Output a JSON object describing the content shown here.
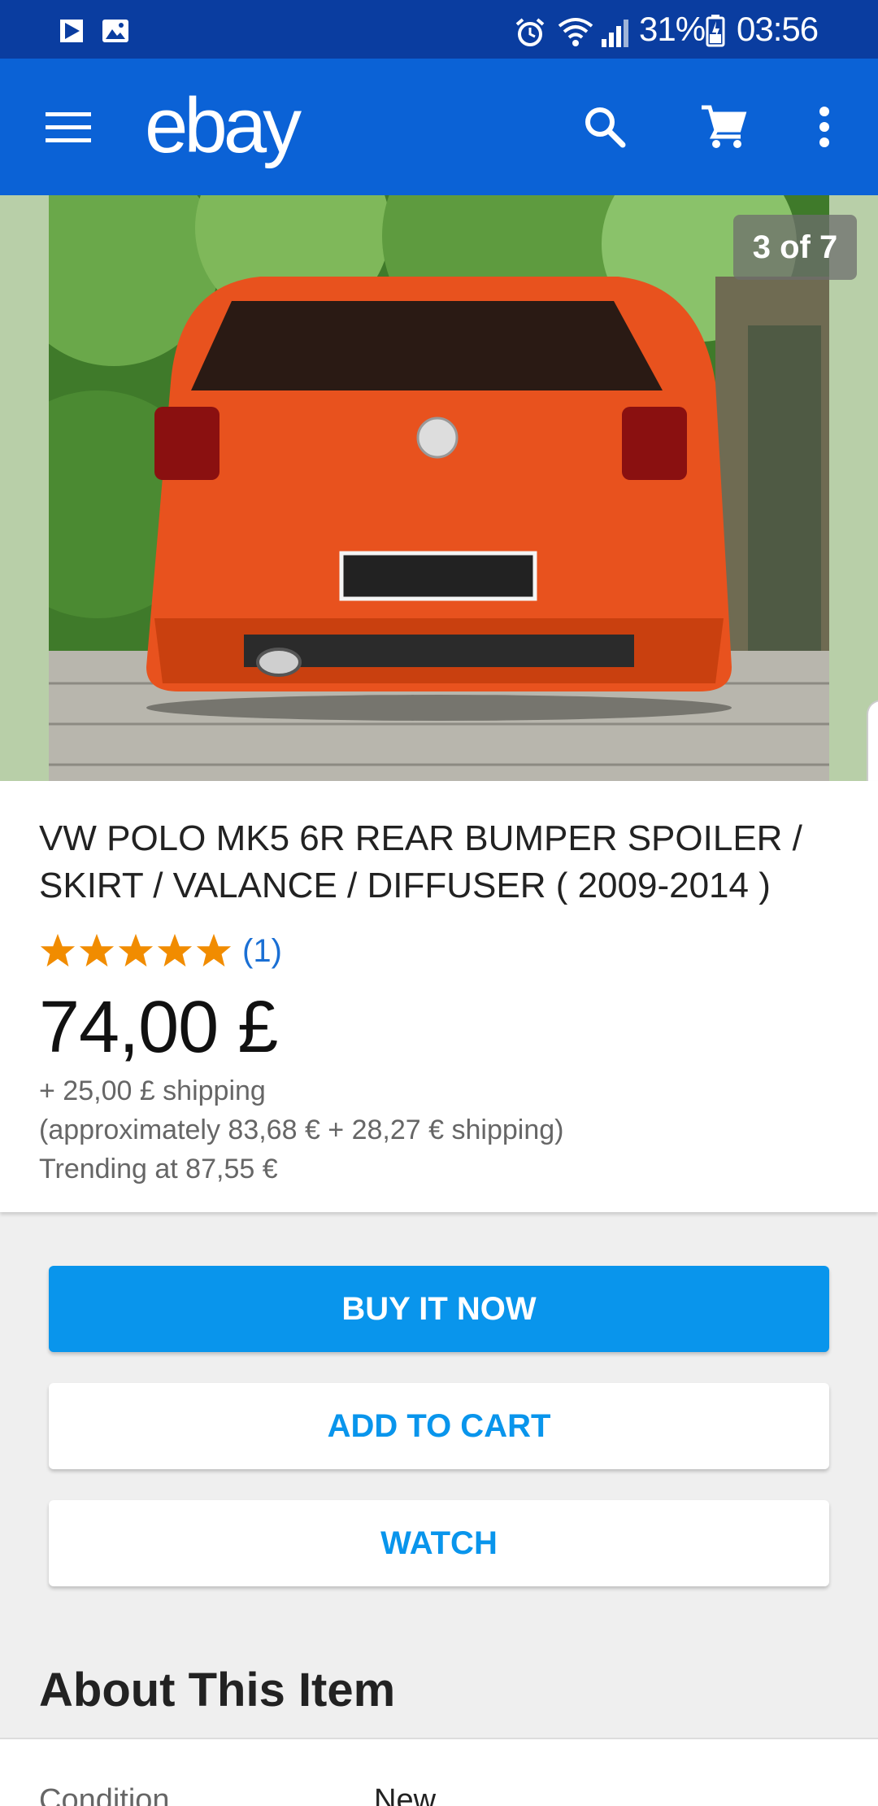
{
  "status_bar": {
    "battery": "31%",
    "time": "03:56"
  },
  "app_bar": {
    "logo": "ebay"
  },
  "gallery": {
    "counter": "3 of 7"
  },
  "item": {
    "title": "VW POLO MK5 6R REAR BUMPER SPOILER / SKIRT / VALANCE / DIFFUSER ( 2009-2014 )",
    "rating": 5,
    "rating_count": "(1)",
    "price": "74,00 £",
    "shipping": "+ 25,00 £ shipping",
    "approx": "(approximately 83,68 € + 28,27 € shipping)",
    "trending": "Trending at 87,55 €"
  },
  "actions": {
    "buy_now": "BUY IT NOW",
    "add_to_cart": "ADD TO CART",
    "watch": "WATCH"
  },
  "about": {
    "heading": "About This Item",
    "condition_label": "Condition",
    "condition_value": "New"
  },
  "colors": {
    "status_bar": "#0a3da0",
    "app_bar": "#0b62d6",
    "primary_button": "#0995ec",
    "star": "#f18c00",
    "link": "#1a6fd4"
  }
}
